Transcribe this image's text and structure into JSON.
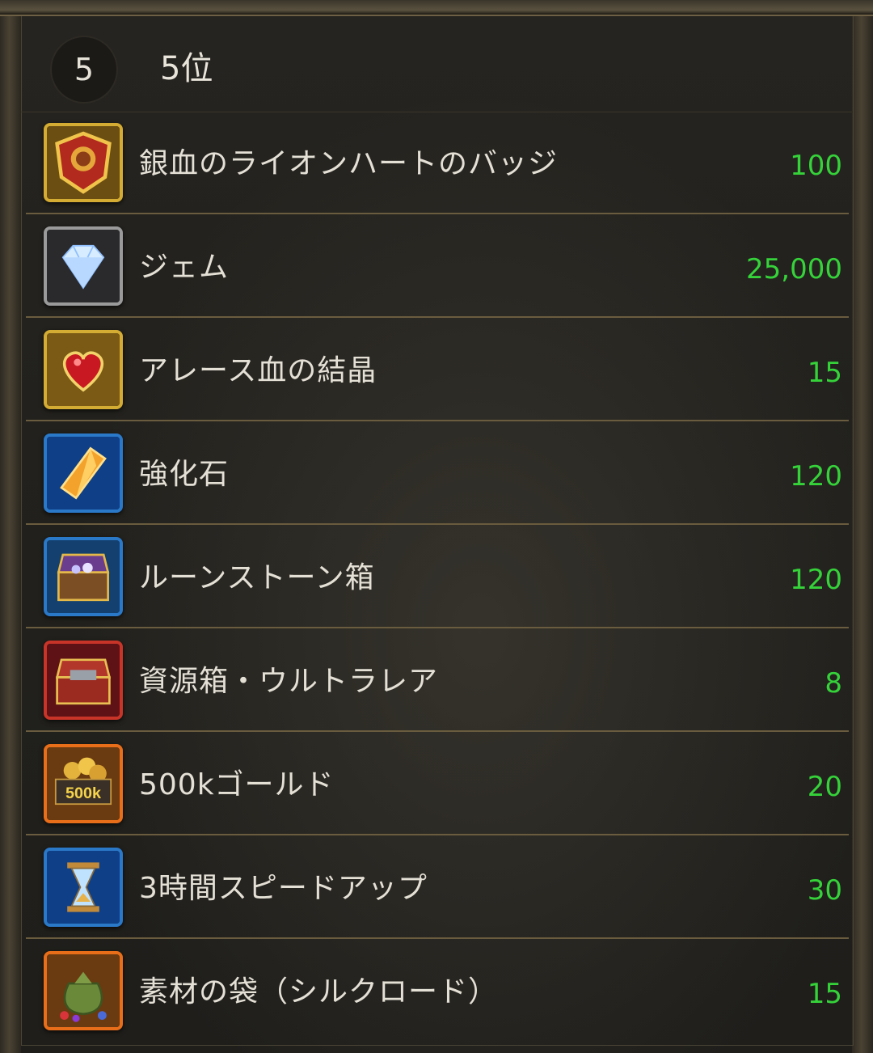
{
  "rank": {
    "badge": "5",
    "title": "5位"
  },
  "colors": {
    "quantity": "#35d23a",
    "divider": "#6a5c3e",
    "text": "#e4e0d6"
  },
  "rewards": [
    {
      "name": "銀血のライオンハートのバッジ",
      "quantity": "100",
      "icon": "lion-badge-icon"
    },
    {
      "name": "ジェム",
      "quantity": "25,000",
      "icon": "gem-icon"
    },
    {
      "name": "アレース血の結晶",
      "quantity": "15",
      "icon": "blood-crystal-icon"
    },
    {
      "name": "強化石",
      "quantity": "120",
      "icon": "enhancement-stone-icon"
    },
    {
      "name": "ルーンストーン箱",
      "quantity": "120",
      "icon": "runestone-chest-icon"
    },
    {
      "name": "資源箱・ウルトラレア",
      "quantity": "8",
      "icon": "resource-chest-icon"
    },
    {
      "name": "500kゴールド",
      "quantity": "20",
      "icon": "gold-500k-icon",
      "icon_text": "500k"
    },
    {
      "name": "3時間スピードアップ",
      "quantity": "30",
      "icon": "hourglass-icon"
    },
    {
      "name": "素材の袋（シルクロード）",
      "quantity": "15",
      "icon": "material-bag-icon"
    }
  ]
}
